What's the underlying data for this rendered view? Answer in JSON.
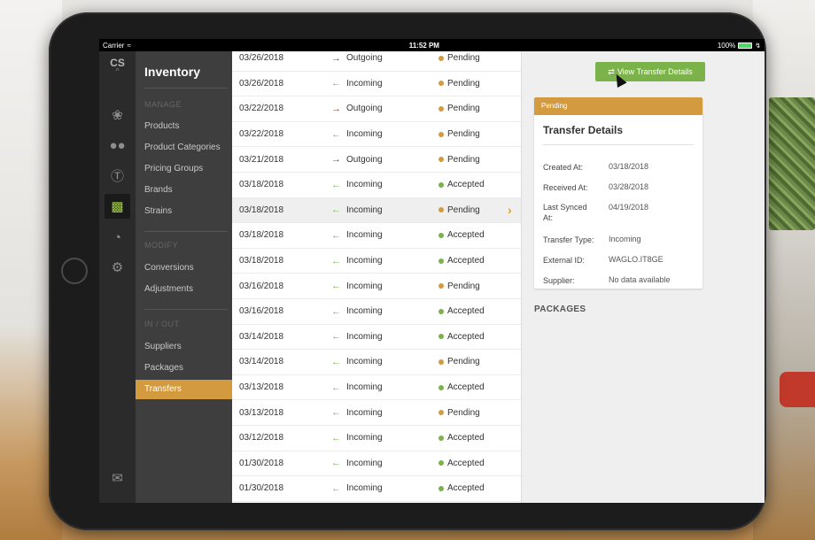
{
  "status_bar": {
    "carrier": "Carrier",
    "time": "11:52 PM",
    "battery": "100%"
  },
  "rail": {
    "logo": "CS",
    "logo_sub": "^"
  },
  "nav": {
    "title": "Inventory",
    "sections": [
      {
        "label": "MANAGE",
        "items": [
          "Products",
          "Product Categories",
          "Pricing Groups",
          "Brands",
          "Strains"
        ]
      },
      {
        "label": "MODIFY",
        "items": [
          "Conversions",
          "Adjustments"
        ]
      },
      {
        "label": "IN / OUT",
        "items": [
          "Suppliers",
          "Packages",
          "Transfers"
        ]
      }
    ],
    "active_item": "Transfers"
  },
  "transfers": [
    {
      "date": "03/26/2018",
      "direction": "Outgoing",
      "status": "Pending"
    },
    {
      "date": "03/26/2018",
      "direction": "Incoming",
      "status": "Pending"
    },
    {
      "date": "03/22/2018",
      "direction": "Outgoing",
      "status": "Pending"
    },
    {
      "date": "03/22/2018",
      "direction": "Incoming",
      "status": "Pending"
    },
    {
      "date": "03/21/2018",
      "direction": "Outgoing",
      "status": "Pending"
    },
    {
      "date": "03/18/2018",
      "direction": "Incoming",
      "status": "Accepted"
    },
    {
      "date": "03/18/2018",
      "direction": "Incoming",
      "status": "Pending",
      "selected": true
    },
    {
      "date": "03/18/2018",
      "direction": "Incoming",
      "status": "Accepted"
    },
    {
      "date": "03/18/2018",
      "direction": "Incoming",
      "status": "Accepted"
    },
    {
      "date": "03/16/2018",
      "direction": "Incoming",
      "status": "Pending"
    },
    {
      "date": "03/16/2018",
      "direction": "Incoming",
      "status": "Accepted"
    },
    {
      "date": "03/14/2018",
      "direction": "Incoming",
      "status": "Accepted"
    },
    {
      "date": "03/14/2018",
      "direction": "Incoming",
      "status": "Pending"
    },
    {
      "date": "03/13/2018",
      "direction": "Incoming",
      "status": "Accepted"
    },
    {
      "date": "03/13/2018",
      "direction": "Incoming",
      "status": "Pending"
    },
    {
      "date": "03/12/2018",
      "direction": "Incoming",
      "status": "Accepted"
    },
    {
      "date": "01/30/2018",
      "direction": "Incoming",
      "status": "Accepted"
    },
    {
      "date": "01/30/2018",
      "direction": "Incoming",
      "status": "Accepted"
    }
  ],
  "colors": {
    "pending": "#d39a3f",
    "accepted": "#7bb34a",
    "outgoing_arrow": "#8a4a1f",
    "incoming_arrow": "#7bb34a",
    "accent": "#d39a3f"
  },
  "detail": {
    "button_label": "View Transfer Details",
    "badge": "Pending",
    "card_title": "Transfer Details",
    "fields": [
      {
        "label": "Created At:",
        "value": "03/18/2018"
      },
      {
        "label": "Received At:",
        "value": "03/28/2018"
      },
      {
        "label": "Last Synced At:",
        "value": "04/19/2018"
      },
      {
        "label": "Transfer Type:",
        "value": "Incoming"
      },
      {
        "label": "External ID:",
        "value": "WAGLO.IT8GE"
      },
      {
        "label": "Supplier:",
        "value": "No data available"
      }
    ],
    "packages_heading": "PACKAGES"
  }
}
